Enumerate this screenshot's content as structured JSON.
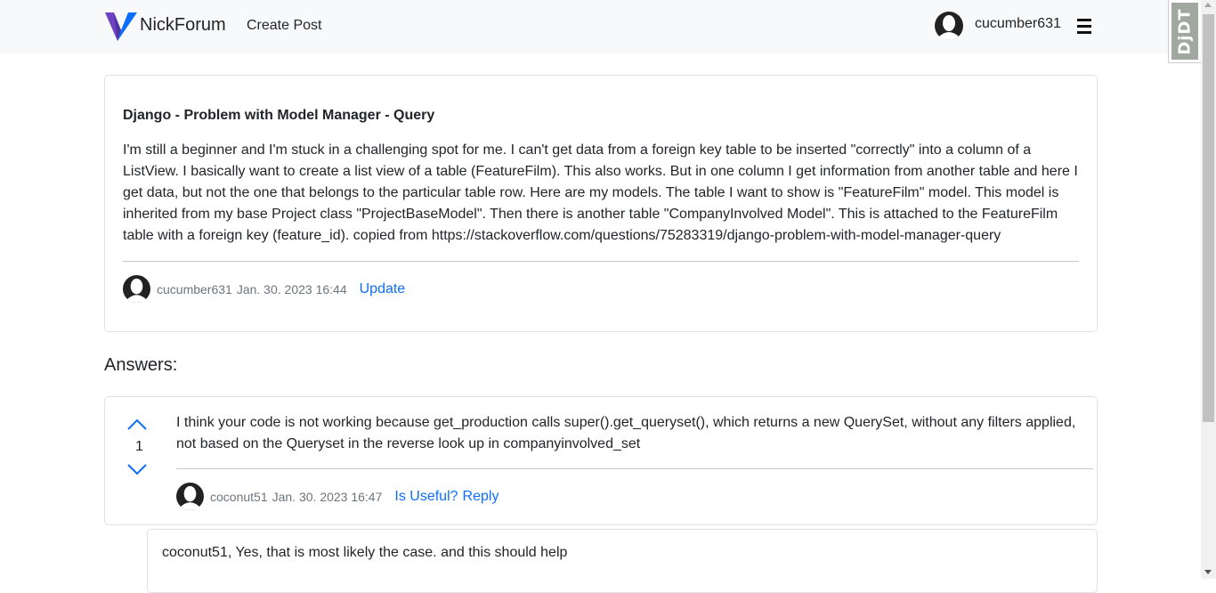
{
  "navbar": {
    "brand": "NickForum",
    "create_post": "Create Post",
    "username": "cucumber631"
  },
  "debug_toolbar": {
    "label": "DjDT"
  },
  "question": {
    "title": "Django - Problem with Model Manager - Query",
    "body": "I'm still a beginner and I'm stuck in a challenging spot for me. I can't get data from a foreign key table to be inserted \"correctly\" into a column of a ListView. I basically want to create a list view of a table (FeatureFilm). This also works. But in one column I get information from another table and here I get data, but not the one that belongs to the particular table row. Here are my models. The table I want to show is \"FeatureFilm\" model. This model is inherited from my base Project class \"ProjectBaseModel\". Then there is another table \"CompanyInvolved Model\". This is attached to the FeatureFilm table with a foreign key (feature_id). copied from https://stackoverflow.com/questions/75283319/django-problem-with-model-manager-query",
    "author": "cucumber631",
    "date": "Jan. 30. 2023 16:44",
    "update_label": "Update"
  },
  "answers_heading": "Answers:",
  "answer": {
    "votes": "1",
    "body": "I think your code is not working because get_production calls super().get_queryset(), which returns a new QuerySet, without any filters applied, not based on the Queryset in the reverse look up in companyinvolved_set",
    "author": "coconut51",
    "date": "Jan. 30. 2023 16:47",
    "useful_label": "Is Useful?",
    "reply_label": "Reply"
  },
  "reply": {
    "body": "coconut51, Yes, that is most likely the case. and this should help"
  },
  "colors": {
    "link": "#0d6efd",
    "navbar_bg": "#f8f9fa",
    "logo_primary": "#6f42c1",
    "logo_secondary": "#0d6efd"
  }
}
